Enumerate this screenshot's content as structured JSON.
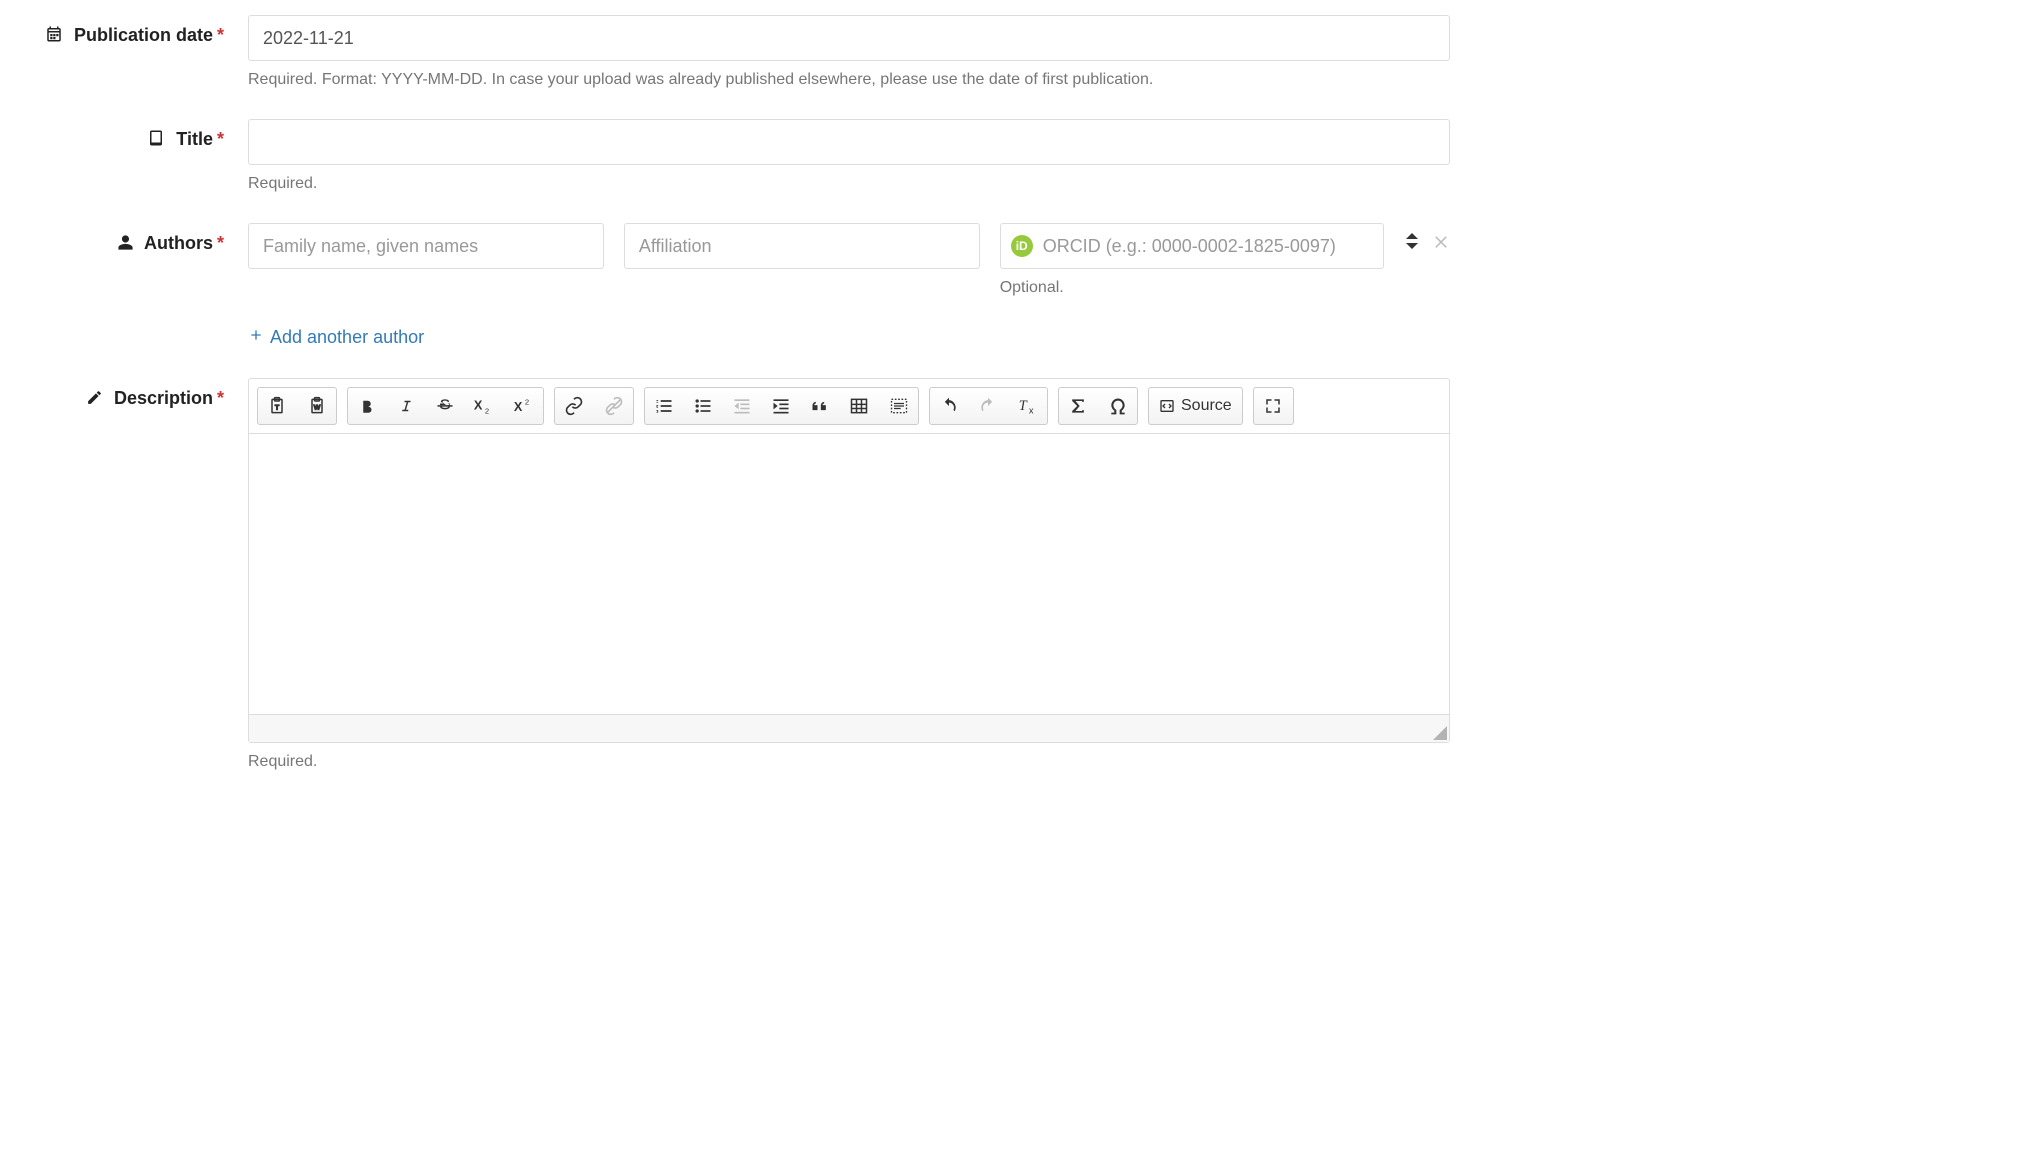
{
  "publication_date": {
    "label": "Publication date",
    "value": "2022-11-21",
    "help": "Required. Format: YYYY-MM-DD. In case your upload was already published elsewhere, please use the date of first publication."
  },
  "title": {
    "label": "Title",
    "value": "",
    "help": "Required."
  },
  "authors": {
    "label": "Authors",
    "name_placeholder": "Family name, given names",
    "affiliation_placeholder": "Affiliation",
    "orcid_placeholder": "ORCID (e.g.: 0000-0002-1825-0097)",
    "orcid_badge": "iD",
    "optional_text": "Optional.",
    "add_link": "Add another author"
  },
  "description": {
    "label": "Description",
    "help": "Required.",
    "source_label": "Source"
  }
}
